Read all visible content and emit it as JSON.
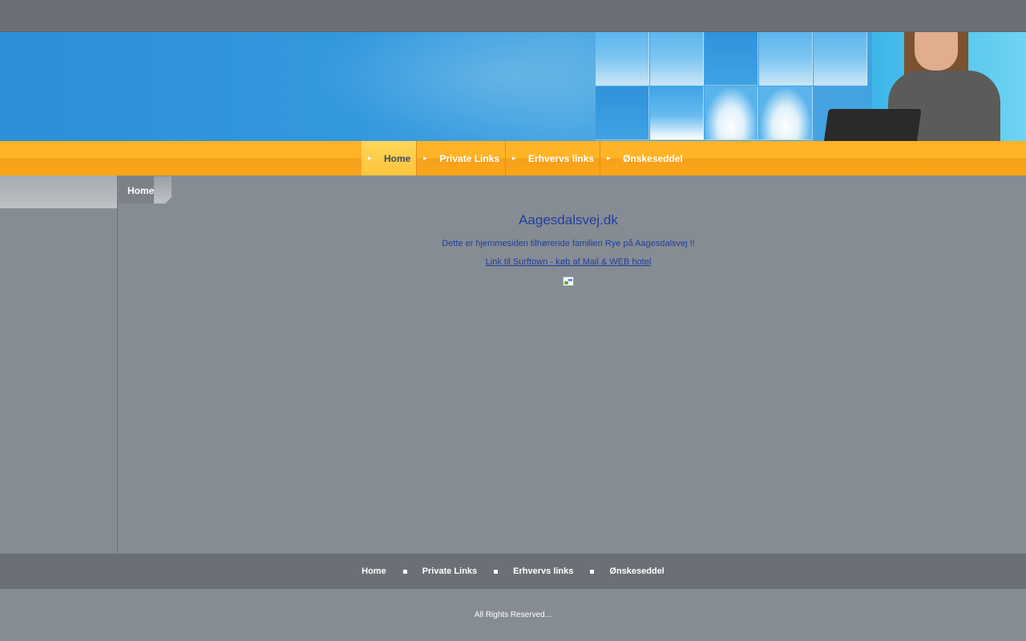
{
  "nav": {
    "items": [
      {
        "label": "Home"
      },
      {
        "label": "Private Links"
      },
      {
        "label": "Erhvervs links"
      },
      {
        "label": "Ønskeseddel"
      }
    ]
  },
  "breadcrumb": {
    "label": "Home"
  },
  "main": {
    "title": "Aagesdalsvej.dk",
    "intro": "Dette er hjemmesiden tilhørende familien Rye på Aagesdalsvej !!",
    "link_text": "Link til Surftown - køb af Mail & WEB hotel"
  },
  "footer_nav": {
    "items": [
      {
        "label": "Home"
      },
      {
        "label": "Private Links"
      },
      {
        "label": "Erhvervs links"
      },
      {
        "label": "Ønskeseddel"
      }
    ]
  },
  "footer": {
    "copyright": "All Rights Reserved..."
  },
  "colors": {
    "nav_orange": "#ffb226",
    "nav_active": "#ffc43c",
    "link_blue": "#1f3f9c",
    "page_gray": "#868c93",
    "bar_gray": "#6b7077"
  },
  "icons": {
    "nav_arrow": "arrow-right-icon",
    "footer_sep": "square-bullet-icon",
    "broken_image": "broken-image-icon"
  }
}
